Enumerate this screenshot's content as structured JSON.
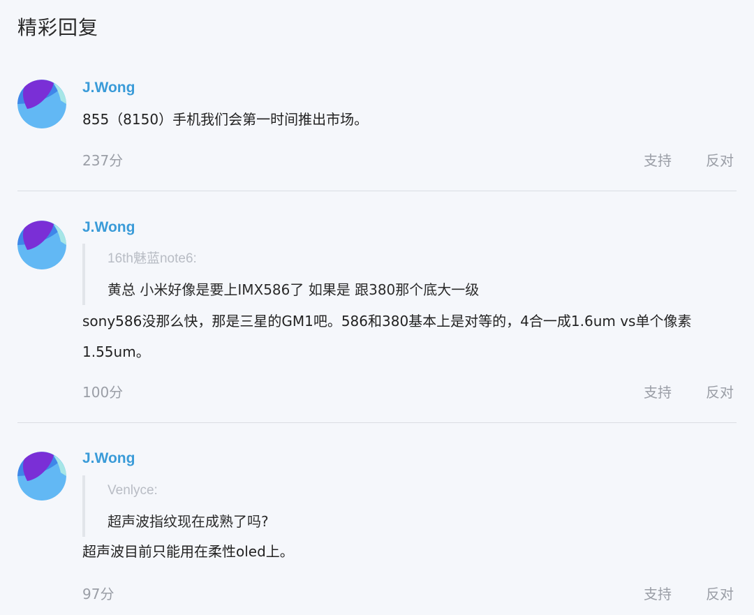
{
  "section": {
    "title": "精彩回复"
  },
  "comments": [
    {
      "author": "J.Wong",
      "quote_author": "",
      "quote_text": "",
      "body": "855（8150）手机我们会第一时间推出市场。",
      "score": "237分",
      "support_label": "支持",
      "oppose_label": "反对"
    },
    {
      "author": "J.Wong",
      "quote_author": "16th魅蓝note6:",
      "quote_text": "黄总 小米好像是要上IMX586了 如果是 跟380那个底大一级",
      "body": "sony586没那么快，那是三星的GM1吧。586和380基本上是对等的，4合一成1.6um vs单个像素1.55um。",
      "score": "100分",
      "support_label": "支持",
      "oppose_label": "反对"
    },
    {
      "author": "J.Wong",
      "quote_author": "Venlyce:",
      "quote_text": "超声波指纹现在成熟了吗?",
      "body": "超声波目前只能用在柔性oled上。",
      "score": "97分",
      "support_label": "支持",
      "oppose_label": "反对"
    }
  ],
  "avatar": {
    "icon": "gradient-circle-avatar",
    "colors": [
      "#7a2fd6",
      "#3fa0ef",
      "#7fd3f7",
      "#9fe0e6"
    ]
  }
}
